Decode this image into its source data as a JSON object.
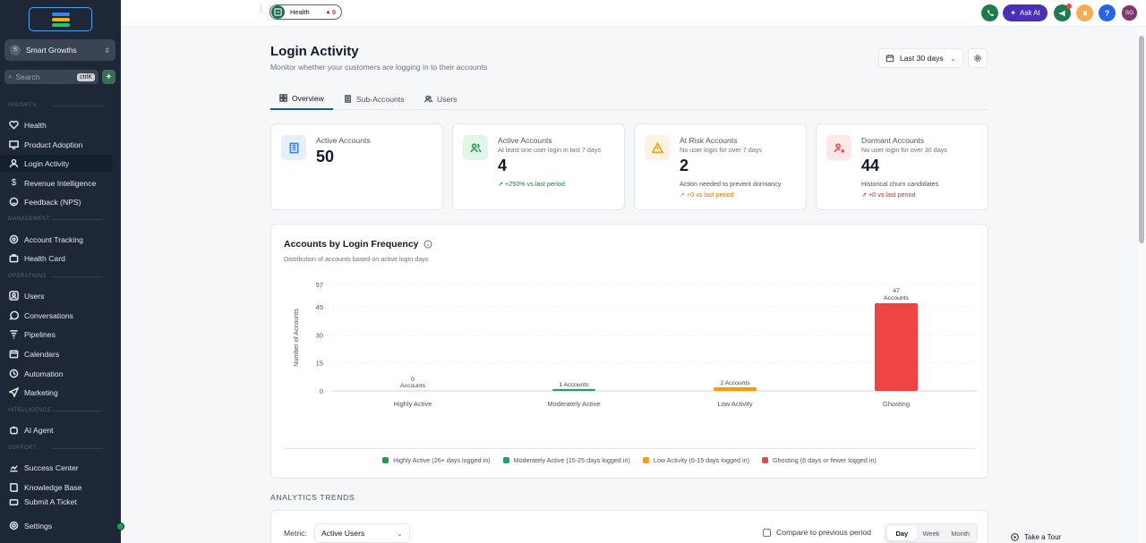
{
  "sidebar": {
    "account": {
      "initial": "S",
      "name": "Smart Growths"
    },
    "search": {
      "placeholder": "Search",
      "shortcut": "ctrlK"
    },
    "sections": {
      "insights": "INSIGHTS",
      "management": "MANAGEMENT",
      "operations": "OPERATIONS",
      "intelligence": "INTELLIGENCE",
      "support": "SUPPORT"
    },
    "items": {
      "health": "Health",
      "product_adoption": "Product Adoption",
      "login_activity": "Login Activity",
      "revenue_intelligence": "Revenue Intelligence",
      "feedback": "Feedback (NPS)",
      "account_tracking": "Account Tracking",
      "health_card": "Health Card",
      "users": "Users",
      "conversations": "Conversations",
      "pipelines": "Pipelines",
      "calendars": "Calendars",
      "automation": "Automation",
      "marketing": "Marketing",
      "ai_agent": "AI Agent",
      "success_center": "Success Center",
      "knowledge_base": "Knowledge Base",
      "submit_ticket": "Submit A Ticket",
      "settings": "Settings"
    }
  },
  "topbar": {
    "health_label": "Health",
    "health_count": "0",
    "ask_ai": "Ask AI",
    "help": "?",
    "avatar_initials": "SG"
  },
  "page": {
    "title": "Login Activity",
    "subtitle": "Monitor whether your customers are logging in to their accounts",
    "date_range": "Last 30 days",
    "tabs": [
      "Overview",
      "Sub-Accounts",
      "Users"
    ]
  },
  "kpis": [
    {
      "title": "Active Accounts",
      "desc": "",
      "value": "50",
      "note": "",
      "trend": "",
      "color": "#3b82f6"
    },
    {
      "title": "Active Accounts",
      "desc": "At least one user login in last 7 days",
      "value": "4",
      "note": "",
      "trend": "+250% vs last period",
      "color": "#16a34a"
    },
    {
      "title": "At Risk Accounts",
      "desc": "No user login for over 7 days",
      "value": "2",
      "note": "Action needed to prevent dormancy",
      "trend": "+0 vs last period",
      "color": "#f59e0b"
    },
    {
      "title": "Dormant Accounts",
      "desc": "No user login for over 30 days",
      "value": "44",
      "note": "Historical churn candidates",
      "trend": "+0 vs last period",
      "color": "#ef4444"
    }
  ],
  "chart_card": {
    "title": "Accounts by Login Frequency",
    "subtitle": "Distribution of accounts based on active login days"
  },
  "chart_data": {
    "type": "bar",
    "categories": [
      "Highly Active",
      "Moderately Active",
      "Low Activity",
      "Ghosting"
    ],
    "values": [
      0,
      1,
      2,
      47
    ],
    "data_labels": [
      "0 Accounts",
      "1 Accounts",
      "2 Accounts",
      "47 Accounts"
    ],
    "colors": [
      "#16a34a",
      "#22a06b",
      "#f59e0b",
      "#ef4444"
    ],
    "ylabel": "Number of Accounts",
    "yticks": [
      0,
      15,
      30,
      45,
      57
    ],
    "ylim": [
      0,
      57
    ],
    "grid": true,
    "legend": [
      "Highly Active (26+ days logged in)",
      "Moderately Active (15-25 days logged in)",
      "Low Activity (6-15 days logged in)",
      "Ghosting (6 days or fewer logged in)"
    ],
    "legend_placement": "bottom"
  },
  "analytics": {
    "heading": "ANALYTICS TRENDS",
    "metric_label": "Metric:",
    "metric_value": "Active Users",
    "compare_label": "Compare to previous period",
    "periods": [
      "Day",
      "Week",
      "Month"
    ],
    "selected_period": "Day"
  },
  "tour": "Take a Tour"
}
